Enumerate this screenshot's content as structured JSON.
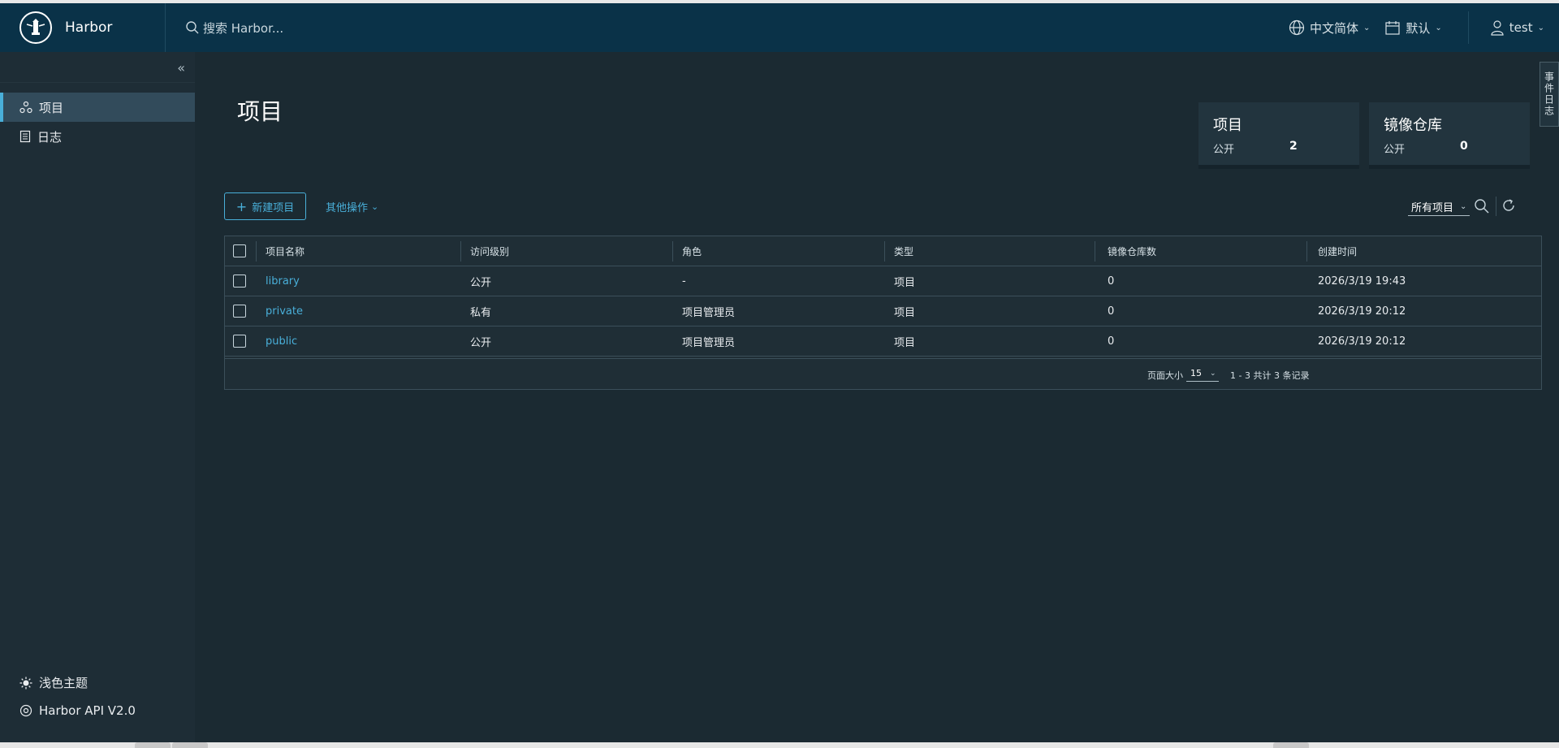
{
  "header": {
    "brand": "Harbor",
    "search_placeholder": "搜索 Harbor...",
    "language": "中文简体",
    "datetime_format": "默认",
    "user": "test"
  },
  "sidebar": {
    "items": [
      {
        "label": "项目",
        "icon": "projects-icon",
        "active": true
      },
      {
        "label": "日志",
        "icon": "logs-icon",
        "active": false
      }
    ],
    "bottom": [
      {
        "label": "浅色主题",
        "icon": "sun-icon"
      },
      {
        "label": "Harbor API V2.0",
        "icon": "api-icon"
      }
    ]
  },
  "main": {
    "title": "项目",
    "cards": [
      {
        "title": "项目",
        "label": "公开",
        "value": "2"
      },
      {
        "title": "镜像仓库",
        "label": "公开",
        "value": "0"
      }
    ],
    "new_project_label": "新建项目",
    "more_actions_label": "其他操作",
    "filter_value": "所有项目",
    "side_tab": "事件日志"
  },
  "table": {
    "columns": [
      "项目名称",
      "访问级别",
      "角色",
      "类型",
      "镜像仓库数",
      "创建时间"
    ],
    "rows": [
      {
        "name": "library",
        "access": "公开",
        "role": "-",
        "type": "项目",
        "repo_count": "0",
        "created": "2026/3/19 19:43"
      },
      {
        "name": "private",
        "access": "私有",
        "role": "项目管理员",
        "type": "项目",
        "repo_count": "0",
        "created": "2026/3/19 20:12"
      },
      {
        "name": "public",
        "access": "公开",
        "role": "项目管理员",
        "type": "项目",
        "repo_count": "0",
        "created": "2026/3/19 20:12"
      }
    ],
    "page_size_label": "页面大小",
    "page_size": "15",
    "page_info": "1 - 3 共计 3 条记录"
  },
  "colors": {
    "header_bg": "#0a3248",
    "sidebar_bg": "#1e2d36",
    "content_bg": "#1b2a32",
    "accent": "#49afd9"
  }
}
